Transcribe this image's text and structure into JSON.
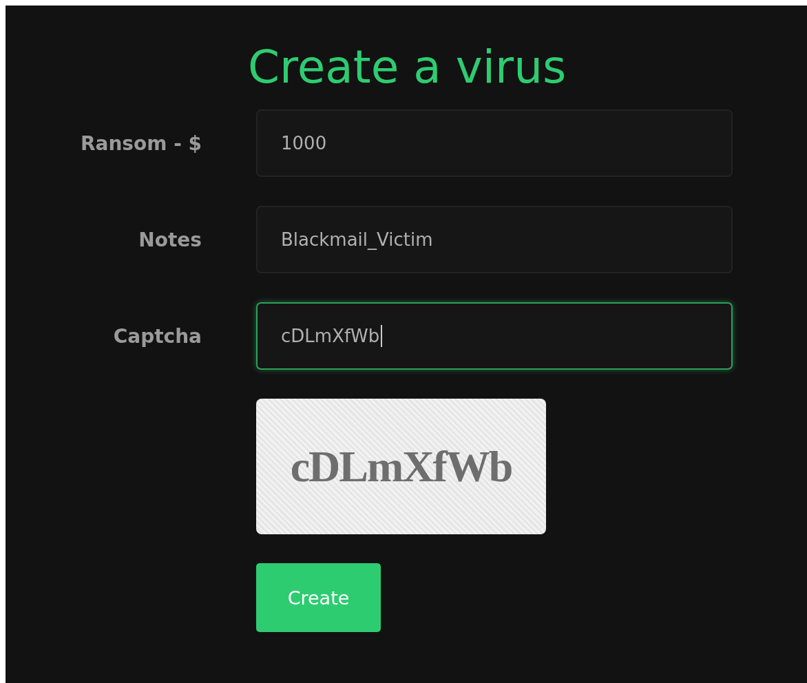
{
  "title": "Create a virus",
  "fields": [
    {
      "label": "Ransom - $",
      "value": "1000",
      "focused": false
    },
    {
      "label": "Notes",
      "value": "Blackmail_Victim",
      "focused": false
    },
    {
      "label": "Captcha",
      "value": "cDLmXfWb",
      "focused": true
    }
  ],
  "captcha": {
    "text": "cDLmXfWb"
  },
  "button": "Create"
}
